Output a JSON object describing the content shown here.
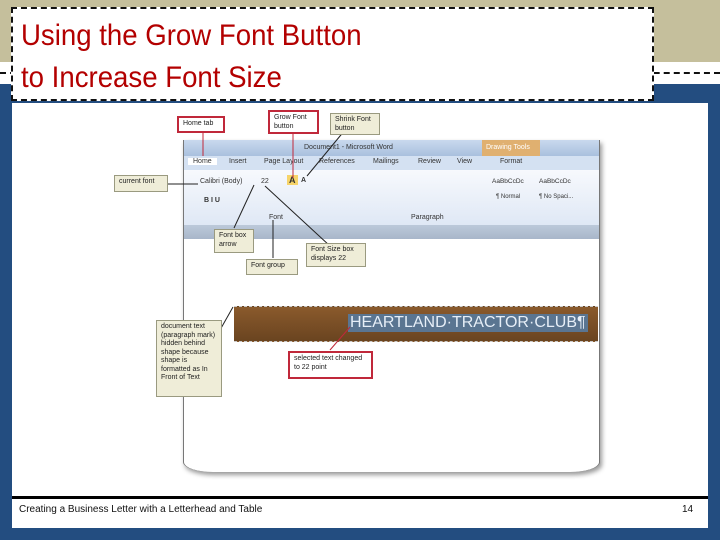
{
  "slide": {
    "title_line1": "Using the Grow Font Button",
    "title_line2": "to Increase Font Size",
    "footer": "Creating a Business Letter with a Letterhead and Table",
    "page_number": "14"
  },
  "word": {
    "window_title": "Document1 - Microsoft Word",
    "contextual_tab": "Drawing Tools",
    "tabs": [
      "Home",
      "Insert",
      "Page Layout",
      "References",
      "Mailings",
      "Review",
      "View",
      "Format"
    ],
    "font_name": "Calibri (Body)",
    "font_size": "22",
    "groups": [
      "Font",
      "Paragraph"
    ],
    "styles": [
      "AaBbCcDc",
      "AaBbCcDc"
    ],
    "style_names": [
      "¶ Normal",
      "¶ No Spaci..."
    ],
    "document_text": "HEARTLAND·TRACTOR·CLUB¶"
  },
  "callouts": {
    "home_tab": "Home tab",
    "grow_font": "Grow Font button",
    "shrink_font": "Shrink Font button",
    "current_font": "current font",
    "font_box_arrow": "Font box arrow",
    "font_group": "Font group",
    "font_size_box": "Font Size box displays 22",
    "hidden_text": "document text (paragraph mark) hidden behind shape because shape is formatted as In Front of Text",
    "selected_text": "selected text changed to 22 point"
  }
}
